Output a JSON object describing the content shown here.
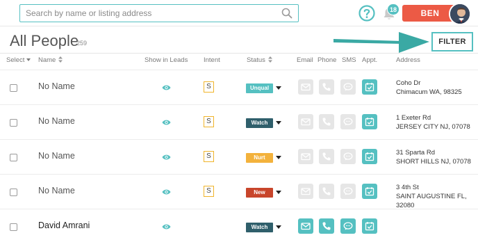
{
  "search": {
    "placeholder": "Search by name or listing address"
  },
  "header": {
    "notification_count": "18",
    "user_label": "BEN",
    "accent": "#55c0c1",
    "user_button_color": "#ec5a45"
  },
  "page": {
    "title": "All People",
    "count": "259",
    "filter_label": "FILTER"
  },
  "columns": {
    "select": "Select",
    "name": "Name",
    "show_in_leads": "Show in Leads",
    "intent": "Intent",
    "status": "Status",
    "email": "Email",
    "phone": "Phone",
    "sms": "SMS",
    "appt": "Appt.",
    "address": "Address"
  },
  "rows": [
    {
      "name": "No Name",
      "intent": "S",
      "status": "Unqual",
      "status_color": "#55c0c1",
      "contact_enabled": false,
      "address_line1": "Coho Dr",
      "address_line2": "Chimacum WA, 98325",
      "address_line3": ""
    },
    {
      "name": "No Name",
      "intent": "S",
      "status": "Watch",
      "status_color": "#2f5f6b",
      "contact_enabled": false,
      "address_line1": "1 Exeter Rd",
      "address_line2": "JERSEY CITY NJ, 07078",
      "address_line3": ""
    },
    {
      "name": "No Name",
      "intent": "S",
      "status": "Nurt",
      "status_color": "#f3b23c",
      "contact_enabled": false,
      "address_line1": "31 Sparta Rd",
      "address_line2": "SHORT HILLS NJ, 07078",
      "address_line3": ""
    },
    {
      "name": "No Name",
      "intent": "S",
      "status": "New",
      "status_color": "#c8452b",
      "contact_enabled": false,
      "address_line1": "3 4th St",
      "address_line2": "SAINT AUGUSTINE FL,",
      "address_line3": "32080"
    },
    {
      "name": "David Amrani",
      "intent": "",
      "status": "Watch",
      "status_color": "#2f5f6b",
      "contact_enabled": true,
      "address_line1": "",
      "address_line2": "",
      "address_line3": ""
    }
  ]
}
